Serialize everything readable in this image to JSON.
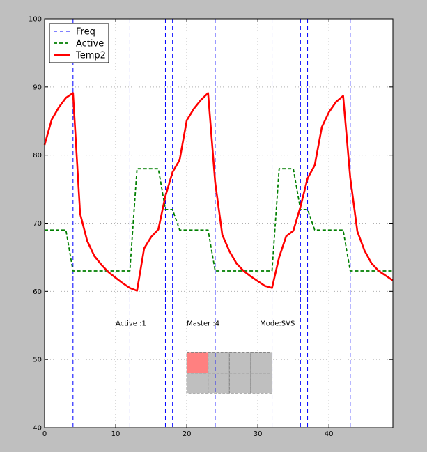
{
  "chart_data": {
    "type": "line",
    "xlim": [
      0,
      49
    ],
    "ylim": [
      40,
      100
    ],
    "grid": true,
    "legend_placement": "top-left",
    "x_ticks": [
      0,
      10,
      20,
      30,
      40
    ],
    "y_ticks": [
      40,
      50,
      60,
      70,
      80,
      90,
      100
    ],
    "series": [
      {
        "name": "Freq",
        "style": "vertical-dashed",
        "color": "#0000ff",
        "x_positions": [
          4,
          12,
          17,
          18,
          24,
          32,
          36,
          37,
          43
        ]
      },
      {
        "name": "Active",
        "style": "dashed",
        "color": "#007f00",
        "x": [
          0,
          1,
          2,
          3,
          4,
          5,
          6,
          7,
          8,
          9,
          10,
          11,
          12,
          13,
          14,
          15,
          16,
          17,
          18,
          19,
          20,
          21,
          22,
          23,
          24,
          25,
          26,
          27,
          28,
          29,
          30,
          31,
          32,
          33,
          34,
          35,
          36,
          37,
          38,
          39,
          40,
          41,
          42,
          43,
          44,
          45,
          46,
          47,
          48,
          49
        ],
        "y": [
          69,
          69,
          69,
          69,
          63,
          63,
          63,
          63,
          63,
          63,
          63,
          63,
          63,
          78,
          78,
          78,
          78,
          72,
          72,
          69,
          69,
          69,
          69,
          69,
          63,
          63,
          63,
          63,
          63,
          63,
          63,
          63,
          63,
          78,
          78,
          78,
          72,
          72,
          69,
          69,
          69,
          69,
          69,
          63,
          63,
          63,
          63,
          63,
          63,
          63
        ]
      },
      {
        "name": "Temp2",
        "style": "solid",
        "color": "#ff0000",
        "x": [
          0,
          1,
          2,
          3,
          4,
          5,
          6,
          7,
          8,
          9,
          10,
          11,
          12,
          13,
          14,
          15,
          16,
          17,
          18,
          19,
          20,
          21,
          22,
          23,
          24,
          25,
          26,
          27,
          28,
          29,
          30,
          31,
          32,
          33,
          34,
          35,
          36,
          37,
          38,
          39,
          40,
          41,
          42,
          43,
          44,
          45,
          46,
          47,
          48,
          49
        ],
        "y": [
          81.5,
          85.2,
          87.0,
          88.4,
          89.1,
          71.4,
          67.4,
          65.2,
          63.9,
          62.8,
          62.0,
          61.2,
          60.5,
          60.1,
          66.3,
          68.0,
          69.1,
          74.0,
          77.5,
          79.3,
          85.1,
          86.8,
          88.1,
          89.1,
          76.0,
          68.3,
          65.9,
          64.1,
          63.0,
          62.2,
          61.5,
          60.8,
          60.5,
          65.0,
          68.1,
          68.9,
          72.4,
          76.6,
          78.5,
          84.1,
          86.3,
          87.8,
          88.7,
          76.7,
          68.8,
          66.0,
          64.1,
          63.0,
          62.3,
          61.6
        ]
      }
    ],
    "annotations": [
      {
        "text": "Active :1",
        "x": 10,
        "y": 55
      },
      {
        "text": "Master :4",
        "x": 20,
        "y": 55
      },
      {
        "text": "Mode:SVS",
        "x": 30.3,
        "y": 55
      }
    ],
    "overlay_cells": [
      {
        "x0": 20,
        "x1": 23,
        "y0": 48,
        "y1": 51,
        "color": "#ff8080"
      },
      {
        "x0": 23,
        "x1": 26,
        "y0": 48,
        "y1": 51,
        "color": "#bfbfbf"
      },
      {
        "x0": 26,
        "x1": 29,
        "y0": 48,
        "y1": 51,
        "color": "#bfbfbf"
      },
      {
        "x0": 29,
        "x1": 32,
        "y0": 48,
        "y1": 51,
        "color": "#bfbfbf"
      },
      {
        "x0": 20,
        "x1": 23,
        "y0": 45,
        "y1": 48,
        "color": "#bfbfbf"
      },
      {
        "x0": 23,
        "x1": 26,
        "y0": 45,
        "y1": 48,
        "color": "#bfbfbf"
      },
      {
        "x0": 26,
        "x1": 29,
        "y0": 45,
        "y1": 48,
        "color": "#bfbfbf"
      },
      {
        "x0": 29,
        "x1": 32,
        "y0": 45,
        "y1": 48,
        "color": "#bfbfbf"
      }
    ],
    "colors": {
      "figure_background": "#bfbfbf",
      "axes_background": "#ffffff",
      "grid": "#b0b0b0"
    }
  }
}
